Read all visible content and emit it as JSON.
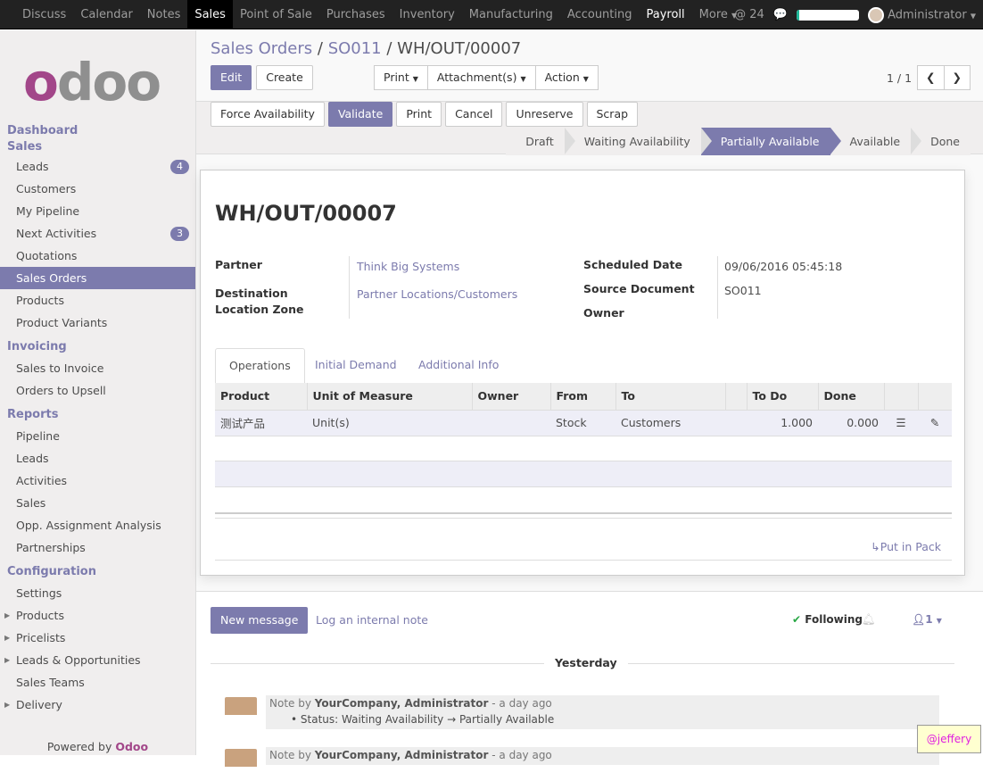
{
  "topbar": {
    "menus": [
      "Discuss",
      "Calendar",
      "Notes",
      "Sales",
      "Point of Sale",
      "Purchases",
      "Inventory",
      "Manufacturing",
      "Accounting",
      "Payroll",
      "More"
    ],
    "active": "Sales",
    "mentions": "24",
    "progress_percent": 5,
    "user": "Administrator"
  },
  "sidebar": {
    "logo": "odoo",
    "sections": [
      {
        "title": "Dashboard",
        "items": []
      },
      {
        "title": "Sales",
        "items": [
          {
            "label": "Leads",
            "badge": "4"
          },
          {
            "label": "Customers"
          },
          {
            "label": "My Pipeline"
          },
          {
            "label": "Next Activities",
            "badge": "3"
          },
          {
            "label": "Quotations"
          },
          {
            "label": "Sales Orders",
            "active": true
          },
          {
            "label": "Products"
          },
          {
            "label": "Product Variants"
          }
        ]
      },
      {
        "title": "Invoicing",
        "items": [
          {
            "label": "Sales to Invoice"
          },
          {
            "label": "Orders to Upsell"
          }
        ]
      },
      {
        "title": "Reports",
        "items": [
          {
            "label": "Pipeline"
          },
          {
            "label": "Leads"
          },
          {
            "label": "Activities"
          },
          {
            "label": "Sales"
          },
          {
            "label": "Opp. Assignment Analysis"
          },
          {
            "label": "Partnerships"
          }
        ]
      },
      {
        "title": "Configuration",
        "items": [
          {
            "label": "Settings"
          },
          {
            "label": "Products",
            "caret": true
          },
          {
            "label": "Pricelists",
            "caret": true
          },
          {
            "label": "Leads & Opportunities",
            "caret": true
          },
          {
            "label": "Sales Teams"
          },
          {
            "label": "Delivery",
            "caret": true
          }
        ]
      }
    ],
    "powered_by": "Powered by",
    "powered_brand": "Odoo"
  },
  "breadcrumb": {
    "items": [
      "Sales Orders",
      "SO011"
    ],
    "current": "WH/OUT/00007"
  },
  "buttons": {
    "edit": "Edit",
    "create": "Create",
    "print": "Print",
    "attachments": "Attachment(s)",
    "action": "Action"
  },
  "pager": {
    "value": "1 / 1"
  },
  "actions": [
    "Force Availability",
    "Validate",
    "Print",
    "Cancel",
    "Unreserve",
    "Scrap"
  ],
  "statusbar": {
    "states": [
      "Draft",
      "Waiting Availability",
      "Partially Available",
      "Available",
      "Done"
    ],
    "current": "Partially Available"
  },
  "record": {
    "name": "WH/OUT/00007",
    "partner_label": "Partner",
    "partner": "Think Big Systems",
    "dest_label": "Destination Location Zone",
    "dest": "Partner Locations/Customers",
    "sched_label": "Scheduled Date",
    "sched": "09/06/2016 05:45:18",
    "src_label": "Source Document",
    "src": "SO011",
    "owner_label": "Owner",
    "owner": ""
  },
  "tabs": [
    "Operations",
    "Initial Demand",
    "Additional Info"
  ],
  "table": {
    "headers": [
      "Product",
      "Unit of Measure",
      "Owner",
      "From",
      "To",
      "",
      "To Do",
      "Done",
      "",
      ""
    ],
    "rows": [
      {
        "product": "测试产品",
        "uom": "Unit(s)",
        "owner": "",
        "from": "Stock",
        "to": "Customers",
        "todo": "1.000",
        "done": "0.000"
      }
    ]
  },
  "put_in_pack": "Put in Pack",
  "chatter": {
    "new_message": "New message",
    "log_note": "Log an internal note",
    "following": "Following",
    "followers": "1",
    "date_sep": "Yesterday",
    "messages": [
      {
        "prefix": "Note by",
        "author": "YourCompany, Administrator",
        "time": "- a day ago",
        "body": "Status: Waiting Availability → Partially Available"
      },
      {
        "prefix": "Note by",
        "author": "YourCompany, Administrator",
        "time": "- a day ago"
      }
    ]
  },
  "watermark": "@jeffery"
}
